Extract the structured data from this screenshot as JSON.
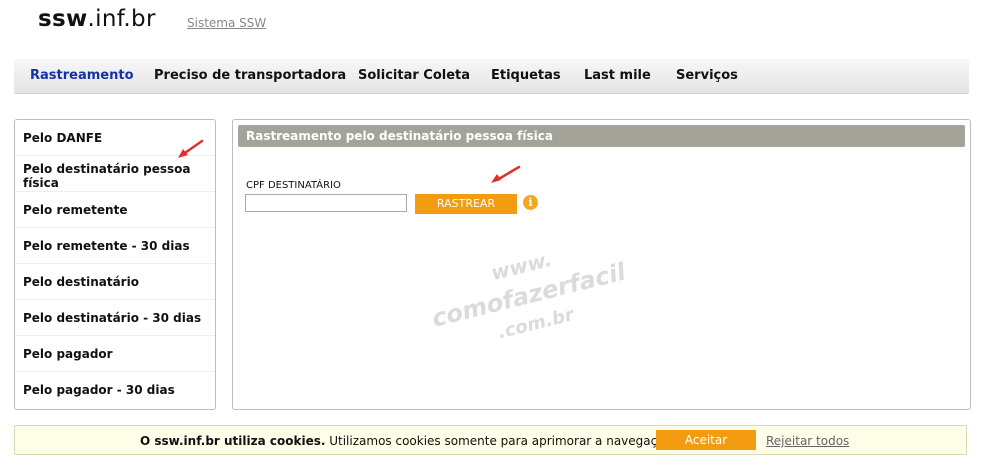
{
  "header": {
    "logo_bold": "ssw",
    "logo_rest": ".inf.br",
    "system_link": "Sistema SSW"
  },
  "nav": {
    "items": [
      {
        "label": "Rastreamento",
        "active": true
      },
      {
        "label": "Preciso de transportadora"
      },
      {
        "label": "Solicitar Coleta"
      },
      {
        "label": "Etiquetas"
      },
      {
        "label": "Last mile"
      },
      {
        "label": "Serviços"
      }
    ]
  },
  "sidebar": {
    "items": [
      {
        "label": "Pelo DANFE"
      },
      {
        "label": "Pelo destinatário pessoa física",
        "selected": true
      },
      {
        "label": "Pelo remetente"
      },
      {
        "label": "Pelo remetente - 30 dias"
      },
      {
        "label": "Pelo destinatário"
      },
      {
        "label": "Pelo destinatário - 30 dias"
      },
      {
        "label": "Pelo pagador"
      },
      {
        "label": "Pelo pagador - 30 dias"
      }
    ]
  },
  "panel": {
    "title": "Rastreamento pelo destinatário pessoa física",
    "field_label": "CPF DESTINATÁRIO",
    "field_value": "",
    "button_label": "RASTREAR",
    "info_icon": "info-icon"
  },
  "watermark": {
    "line1": "www.",
    "line2": "comofazerfacil",
    "line3": ".com.br"
  },
  "cookie": {
    "bold_text": "O ssw.inf.br utiliza cookies.",
    "text": " Utilizamos cookies somente para aprimorar a navegação.",
    "accept_label": "Aceitar",
    "reject_label": "Rejeitar todos"
  },
  "colors": {
    "accent_orange": "#f39c12",
    "active_nav": "#1432a8",
    "panel_header": "#a3a399",
    "annotation_arrow": "#e0302a"
  }
}
